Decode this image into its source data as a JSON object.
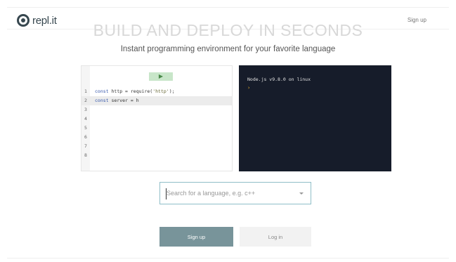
{
  "header": {
    "logo_text": "repl.it",
    "signup_link": "Sign up"
  },
  "hero": {
    "headline": "BUILD AND DEPLOY IN SECONDS",
    "tagline": "Instant programming environment for your favorite language"
  },
  "editor": {
    "run_icon": "play-icon",
    "lines": [
      {
        "num": "1",
        "code": [
          {
            "t": "const",
            "c": "kw"
          },
          {
            "t": " http = require(",
            "c": ""
          },
          {
            "t": "'http'",
            "c": "str"
          },
          {
            "t": ");",
            "c": ""
          }
        ]
      },
      {
        "num": "2",
        "code": [
          {
            "t": "const",
            "c": "kw"
          },
          {
            "t": " server = h",
            "c": ""
          }
        ]
      },
      {
        "num": "3",
        "code": []
      },
      {
        "num": "4",
        "code": []
      },
      {
        "num": "5",
        "code": []
      },
      {
        "num": "6",
        "code": []
      },
      {
        "num": "7",
        "code": []
      },
      {
        "num": "8",
        "code": []
      }
    ],
    "active_line": 2
  },
  "console": {
    "output": "Node.js v9.8.0 on linux",
    "prompt": "›"
  },
  "search": {
    "placeholder": "Search for a language, e.g. c++"
  },
  "actions": {
    "signup_label": "Sign up",
    "login_label": "Log in"
  },
  "colors": {
    "console_bg": "#161c2a",
    "prompt": "#f0b429",
    "run_button": "#c8e6c9",
    "signup_button": "#78949a",
    "search_border": "#8fbec8"
  }
}
